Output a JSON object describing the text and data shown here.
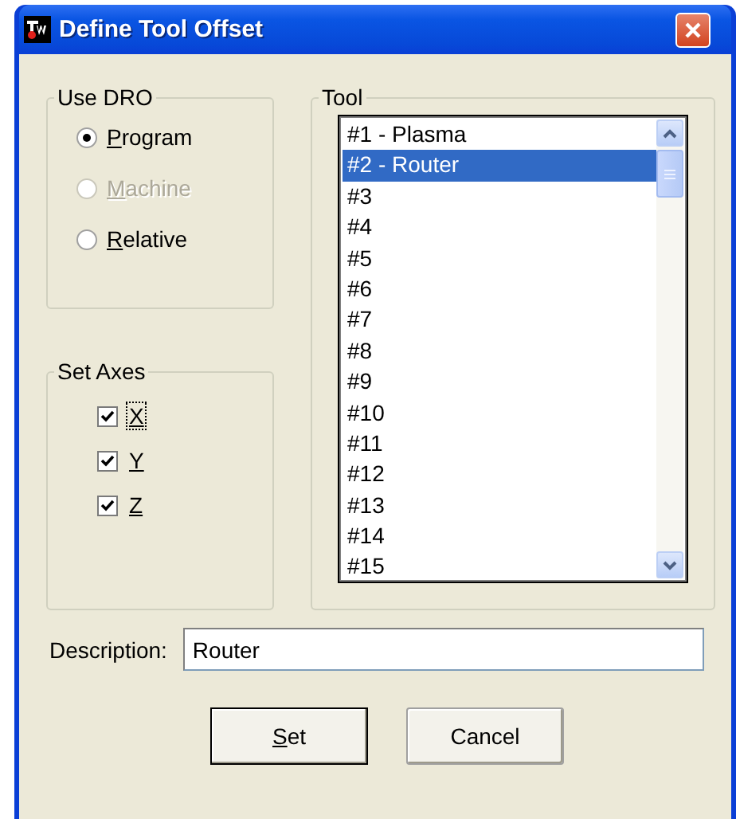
{
  "window": {
    "title": "Define Tool Offset"
  },
  "use_dro": {
    "label": "Use DRO",
    "options": [
      {
        "label": "Program",
        "selected": true,
        "disabled": false
      },
      {
        "label": "Machine",
        "selected": false,
        "disabled": true
      },
      {
        "label": "Relative",
        "selected": false,
        "disabled": false
      }
    ]
  },
  "set_axes": {
    "label": "Set Axes",
    "axes": [
      {
        "label": "X",
        "checked": true,
        "focused": true
      },
      {
        "label": "Y",
        "checked": true,
        "focused": false
      },
      {
        "label": "Z",
        "checked": true,
        "focused": false
      }
    ]
  },
  "tool": {
    "label": "Tool",
    "items": [
      {
        "label": "#1 - Plasma",
        "selected": false
      },
      {
        "label": "#2 - Router",
        "selected": true
      },
      {
        "label": "#3",
        "selected": false
      },
      {
        "label": "#4",
        "selected": false
      },
      {
        "label": "#5",
        "selected": false
      },
      {
        "label": "#6",
        "selected": false
      },
      {
        "label": "#7",
        "selected": false
      },
      {
        "label": "#8",
        "selected": false
      },
      {
        "label": "#9",
        "selected": false
      },
      {
        "label": "#10",
        "selected": false
      },
      {
        "label": "#11",
        "selected": false
      },
      {
        "label": "#12",
        "selected": false
      },
      {
        "label": "#13",
        "selected": false
      },
      {
        "label": "#14",
        "selected": false
      },
      {
        "label": "#15",
        "selected": false
      }
    ]
  },
  "description": {
    "label": "Description:",
    "value": "Router"
  },
  "buttons": [
    {
      "label": "Set",
      "default": true
    },
    {
      "label": "Cancel",
      "default": false
    }
  ]
}
